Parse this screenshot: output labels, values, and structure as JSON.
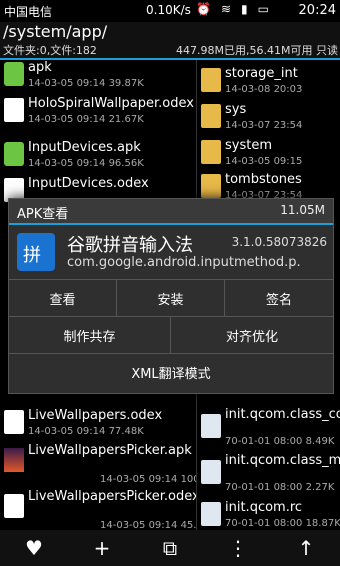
{
  "status": {
    "carrier": "中国电信",
    "speed": "0.10K/s",
    "time": "20:24",
    "icons": [
      "alarm-icon",
      "wifi-icon",
      "signal-icon",
      "battery-icon"
    ]
  },
  "path": "/system/app/",
  "info": {
    "left": "文件夹:0,文件:182",
    "right": "447.98M已用,56.41M可用 只读"
  },
  "left_files": [
    {
      "name": "apk",
      "meta": "14-03-05 09:14 39.87K",
      "type": "apk"
    },
    {
      "name": "HoloSpiralWallpaper.odex",
      "meta": "14-03-05 09:14 21.67K",
      "type": "doc"
    },
    {
      "name": "InputDevices.apk",
      "meta": "14-03-05 09:14 96.56K",
      "type": "apk"
    },
    {
      "name": "InputDevices.odex",
      "meta": "",
      "type": "doc"
    },
    {
      "name": "LiveWallpapers.odex",
      "meta": "14-03-05 09:14 77.48K",
      "type": "doc"
    },
    {
      "name": "LiveWallpapersPicker.apk",
      "meta": "14-03-05 09:14 100.66K",
      "type": "img"
    },
    {
      "name": "LiveWallpapersPicker.odex",
      "meta": "14-03-05 09:14 45.24K",
      "type": "doc"
    }
  ],
  "right_files": [
    {
      "name": "storage_int",
      "meta": "14-03-08 20:03",
      "type": "folder"
    },
    {
      "name": "sys",
      "meta": "14-03-07 23:54",
      "type": "folder"
    },
    {
      "name": "system",
      "meta": "14-03-05 09:15",
      "type": "folder"
    },
    {
      "name": "tombstones",
      "meta": "14-03-07 23:54",
      "type": "folder"
    },
    {
      "name": "init.qcom.class_core.sh",
      "meta": "70-01-01 08:00 8.49K",
      "type": "gear"
    },
    {
      "name": "init.qcom.class_main.sh",
      "meta": "70-01-01 08:00 2.27K",
      "type": "gear"
    },
    {
      "name": "init.qcom.rc",
      "meta": "70-01-01 08:00 18.87K",
      "type": "gear"
    }
  ],
  "dialog": {
    "title": "APK查看",
    "size": "11.05M",
    "app_name": "谷歌拼音输入法",
    "version": "3.1.0.58073826",
    "package": "com.google.android.inputmethod.p.",
    "icon_text": "拼",
    "buttons": {
      "view": "查看",
      "install": "安装",
      "sign": "签名",
      "make_share": "制作共存",
      "align_opt": "对齐优化",
      "xml_mode": "XML翻译模式"
    }
  },
  "bottom": {
    "fav": "♥",
    "add": "+",
    "multi": "⧉",
    "more": "⋮",
    "up": "↑"
  }
}
